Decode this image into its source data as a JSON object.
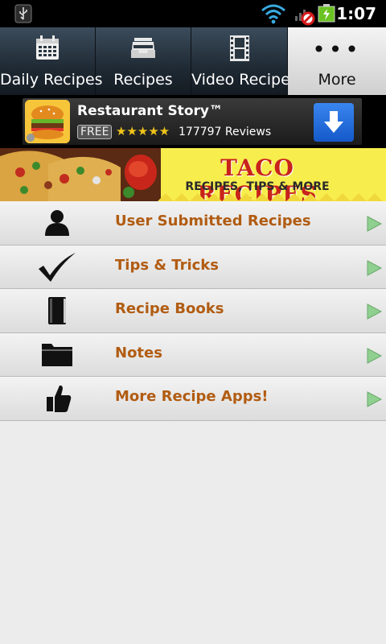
{
  "status_bar": {
    "time": "1:07",
    "icons": [
      "usb-icon",
      "wifi-icon",
      "signal-blocked-icon",
      "battery-charging-icon"
    ]
  },
  "tabs": [
    {
      "label": "Daily Recipes",
      "icon": "calendar-icon",
      "selected": false
    },
    {
      "label": "Recipes",
      "icon": "inbox-tray-icon",
      "selected": false
    },
    {
      "label": "Video Recipes",
      "icon": "film-icon",
      "selected": false
    },
    {
      "label": "More",
      "icon": "more-dots-icon",
      "selected": true
    }
  ],
  "ad": {
    "title": "Restaurant Story™",
    "price_badge": "FREE",
    "rating_stars": 4.5,
    "stars_text": "★★★★★",
    "reviews": "177797 Reviews",
    "icon": "burger-app-icon",
    "button_icon": "download-arrow-icon"
  },
  "banner": {
    "title": "TACO RECIPES",
    "subtitle": "RECIPES, TIPS & MORE"
  },
  "menu": [
    {
      "label": "User Submitted Recipes",
      "icon": "user-icon"
    },
    {
      "label": "Tips & Tricks",
      "icon": "checkmark-icon"
    },
    {
      "label": "Recipe Books",
      "icon": "book-icon"
    },
    {
      "label": "Notes",
      "icon": "folder-icon"
    },
    {
      "label": "More Recipe Apps!",
      "icon": "thumbs-up-icon"
    }
  ],
  "colors": {
    "menu_text": "#b15c12",
    "banner_bg": "#f7ee4e",
    "banner_title": "#c8231a",
    "arrow": "#8fcf8f"
  }
}
